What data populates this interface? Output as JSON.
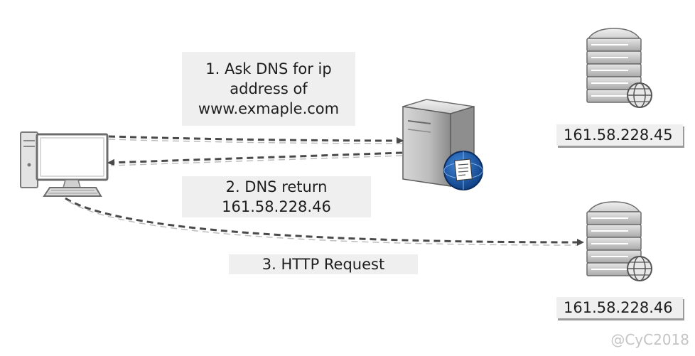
{
  "steps": {
    "step1_line1": "1. Ask DNS for ip",
    "step1_line2": "address of",
    "step1_line3": "www.exmaple.com",
    "step2_line1": "2. DNS return",
    "step2_line2": "161.58.228.46",
    "step3": "3. HTTP Request"
  },
  "servers": {
    "server_a_ip": "161.58.228.45",
    "server_b_ip": "161.58.228.46"
  },
  "watermark": "@CyC2018",
  "colors": {
    "arrow": "#4a4a4a",
    "label_background": "#efefef",
    "watermark": "#c4c4c4",
    "globe": "#1f5aa8"
  },
  "icons": {
    "client": "desktop-computer-icon",
    "dns": "dns-server-icon",
    "web_servers": "web-server-rack-icon"
  }
}
